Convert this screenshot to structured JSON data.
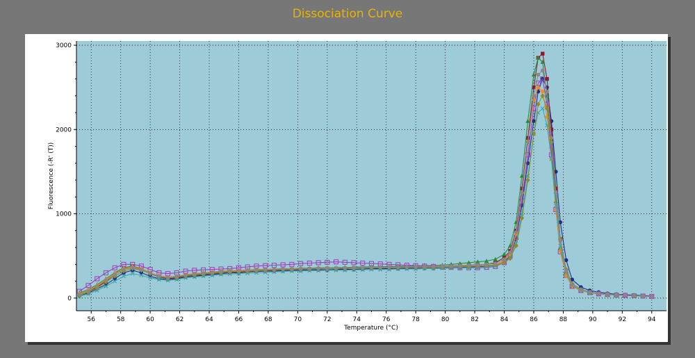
{
  "title": "Dissociation Curve",
  "chart_data": {
    "type": "line",
    "title": "Dissociation Curve",
    "xlabel": "Temperature (°C)",
    "ylabel": "Fluorescence (-R' (T))",
    "xlim": [
      55,
      95
    ],
    "ylim": [
      -150,
      3050
    ],
    "x_ticks": [
      56,
      58,
      60,
      62,
      64,
      66,
      68,
      70,
      72,
      74,
      76,
      78,
      80,
      82,
      84,
      86,
      88,
      90,
      92,
      94
    ],
    "y_ticks": [
      0,
      1000,
      2000,
      3000
    ],
    "grid": true,
    "plot_background": "#9ecbd8",
    "x": [
      55.2,
      55.8,
      56.4,
      57.0,
      57.6,
      58.2,
      58.8,
      59.4,
      60.0,
      60.6,
      61.2,
      61.8,
      62.4,
      63.0,
      63.6,
      64.2,
      64.8,
      65.4,
      66.0,
      66.6,
      67.2,
      67.8,
      68.4,
      69.0,
      69.6,
      70.2,
      70.8,
      71.4,
      72.0,
      72.6,
      73.2,
      73.8,
      74.4,
      75.0,
      75.6,
      76.2,
      76.8,
      77.4,
      78.0,
      78.6,
      79.2,
      79.8,
      80.4,
      81.0,
      81.6,
      82.2,
      82.8,
      83.4,
      84.0,
      84.4,
      84.8,
      85.2,
      85.6,
      86.0,
      86.3,
      86.6,
      86.9,
      87.2,
      87.5,
      87.8,
      88.2,
      88.6,
      89.2,
      89.8,
      90.4,
      91.0,
      91.6,
      92.2,
      92.8,
      93.4,
      94.0
    ],
    "series": [
      {
        "color": "#1a2e8c",
        "marker": "circle",
        "values": [
          30,
          60,
          110,
          160,
          230,
          300,
          330,
          300,
          260,
          230,
          220,
          230,
          250,
          260,
          270,
          280,
          290,
          300,
          300,
          310,
          315,
          320,
          320,
          325,
          330,
          330,
          335,
          335,
          335,
          340,
          340,
          340,
          345,
          350,
          350,
          350,
          350,
          355,
          355,
          355,
          355,
          360,
          360,
          365,
          370,
          370,
          380,
          390,
          440,
          500,
          700,
          1100,
          1600,
          2100,
          2450,
          2600,
          2500,
          2100,
          1500,
          900,
          450,
          220,
          130,
          90,
          70,
          55,
          45,
          40,
          35,
          30,
          25
        ]
      },
      {
        "color": "#8c1a2e",
        "marker": "square",
        "values": [
          40,
          80,
          130,
          200,
          280,
          350,
          370,
          340,
          290,
          250,
          230,
          240,
          260,
          270,
          280,
          290,
          300,
          305,
          310,
          315,
          320,
          325,
          330,
          335,
          340,
          340,
          345,
          345,
          350,
          350,
          350,
          355,
          355,
          360,
          360,
          360,
          365,
          365,
          365,
          370,
          370,
          375,
          380,
          385,
          390,
          395,
          400,
          420,
          480,
          560,
          800,
          1300,
          1900,
          2500,
          2850,
          2900,
          2600,
          2000,
          1300,
          700,
          320,
          160,
          100,
          70,
          55,
          45,
          40,
          35,
          30,
          25,
          22
        ]
      },
      {
        "color": "#2a8c3a",
        "marker": "triangle",
        "values": [
          60,
          100,
          160,
          230,
          300,
          360,
          380,
          350,
          300,
          260,
          240,
          250,
          270,
          280,
          290,
          300,
          310,
          320,
          325,
          330,
          335,
          340,
          345,
          350,
          350,
          355,
          355,
          360,
          360,
          360,
          365,
          365,
          370,
          370,
          370,
          375,
          375,
          380,
          380,
          385,
          385,
          390,
          400,
          410,
          420,
          430,
          440,
          460,
          520,
          620,
          900,
          1450,
          2100,
          2650,
          2850,
          2800,
          2400,
          1800,
          1150,
          600,
          280,
          140,
          90,
          65,
          50,
          42,
          36,
          32,
          28,
          24,
          20
        ]
      },
      {
        "color": "#9b3fb8",
        "marker": "open-square",
        "values": [
          80,
          150,
          230,
          300,
          360,
          400,
          400,
          380,
          340,
          300,
          290,
          300,
          320,
          330,
          335,
          340,
          345,
          350,
          360,
          370,
          380,
          385,
          390,
          395,
          400,
          410,
          415,
          420,
          425,
          430,
          425,
          420,
          415,
          410,
          405,
          400,
          395,
          390,
          385,
          380,
          375,
          370,
          365,
          360,
          360,
          360,
          365,
          375,
          420,
          500,
          720,
          1150,
          1700,
          2250,
          2550,
          2600,
          2300,
          1700,
          1050,
          550,
          270,
          140,
          90,
          65,
          50,
          42,
          36,
          32,
          28,
          24,
          20
        ]
      },
      {
        "color": "#f08a1c",
        "marker": "diamond",
        "values": [
          50,
          90,
          150,
          220,
          290,
          350,
          370,
          345,
          300,
          265,
          250,
          260,
          280,
          290,
          300,
          310,
          320,
          325,
          330,
          335,
          340,
          340,
          345,
          345,
          350,
          350,
          350,
          355,
          355,
          355,
          360,
          360,
          360,
          360,
          365,
          365,
          365,
          365,
          370,
          370,
          370,
          370,
          375,
          375,
          380,
          380,
          385,
          395,
          440,
          520,
          760,
          1250,
          1850,
          2350,
          2500,
          2450,
          2150,
          1650,
          1050,
          560,
          270,
          140,
          90,
          65,
          50,
          42,
          36,
          32,
          28,
          24,
          20
        ]
      },
      {
        "color": "#3fa8a8",
        "marker": "x",
        "values": [
          20,
          50,
          90,
          140,
          200,
          260,
          290,
          270,
          240,
          220,
          210,
          220,
          240,
          250,
          260,
          270,
          280,
          285,
          290,
          295,
          300,
          305,
          310,
          315,
          320,
          320,
          325,
          325,
          330,
          330,
          330,
          335,
          335,
          340,
          340,
          340,
          345,
          345,
          345,
          350,
          350,
          355,
          355,
          360,
          360,
          365,
          370,
          380,
          420,
          480,
          650,
          1000,
          1450,
          1950,
          2200,
          2250,
          2050,
          1650,
          1100,
          620,
          300,
          150,
          95,
          68,
          52,
          43,
          37,
          32,
          28,
          24,
          20
        ]
      },
      {
        "color": "#8c8c2a",
        "marker": "diamond",
        "values": [
          30,
          70,
          120,
          190,
          260,
          320,
          350,
          330,
          290,
          255,
          240,
          250,
          265,
          275,
          285,
          295,
          305,
          310,
          315,
          320,
          325,
          330,
          335,
          340,
          340,
          345,
          345,
          350,
          350,
          350,
          355,
          355,
          355,
          360,
          360,
          360,
          360,
          365,
          365,
          365,
          365,
          370,
          370,
          375,
          375,
          380,
          385,
          390,
          420,
          470,
          620,
          950,
          1400,
          1950,
          2300,
          2400,
          2250,
          1850,
          1250,
          700,
          340,
          170,
          105,
          72,
          55,
          45,
          38,
          33,
          28,
          24,
          20
        ]
      },
      {
        "color": "#888888",
        "marker": "circle",
        "values": [
          40,
          80,
          140,
          210,
          280,
          340,
          360,
          335,
          295,
          260,
          245,
          255,
          275,
          285,
          295,
          305,
          315,
          320,
          325,
          330,
          335,
          340,
          340,
          345,
          345,
          350,
          350,
          355,
          355,
          355,
          360,
          360,
          360,
          365,
          365,
          365,
          370,
          370,
          370,
          375,
          375,
          380,
          380,
          385,
          390,
          395,
          400,
          410,
          460,
          540,
          780,
          1250,
          1850,
          2400,
          2650,
          2700,
          2450,
          1900,
          1250,
          680,
          320,
          160,
          100,
          70,
          55,
          45,
          38,
          33,
          28,
          24,
          20
        ]
      }
    ]
  }
}
